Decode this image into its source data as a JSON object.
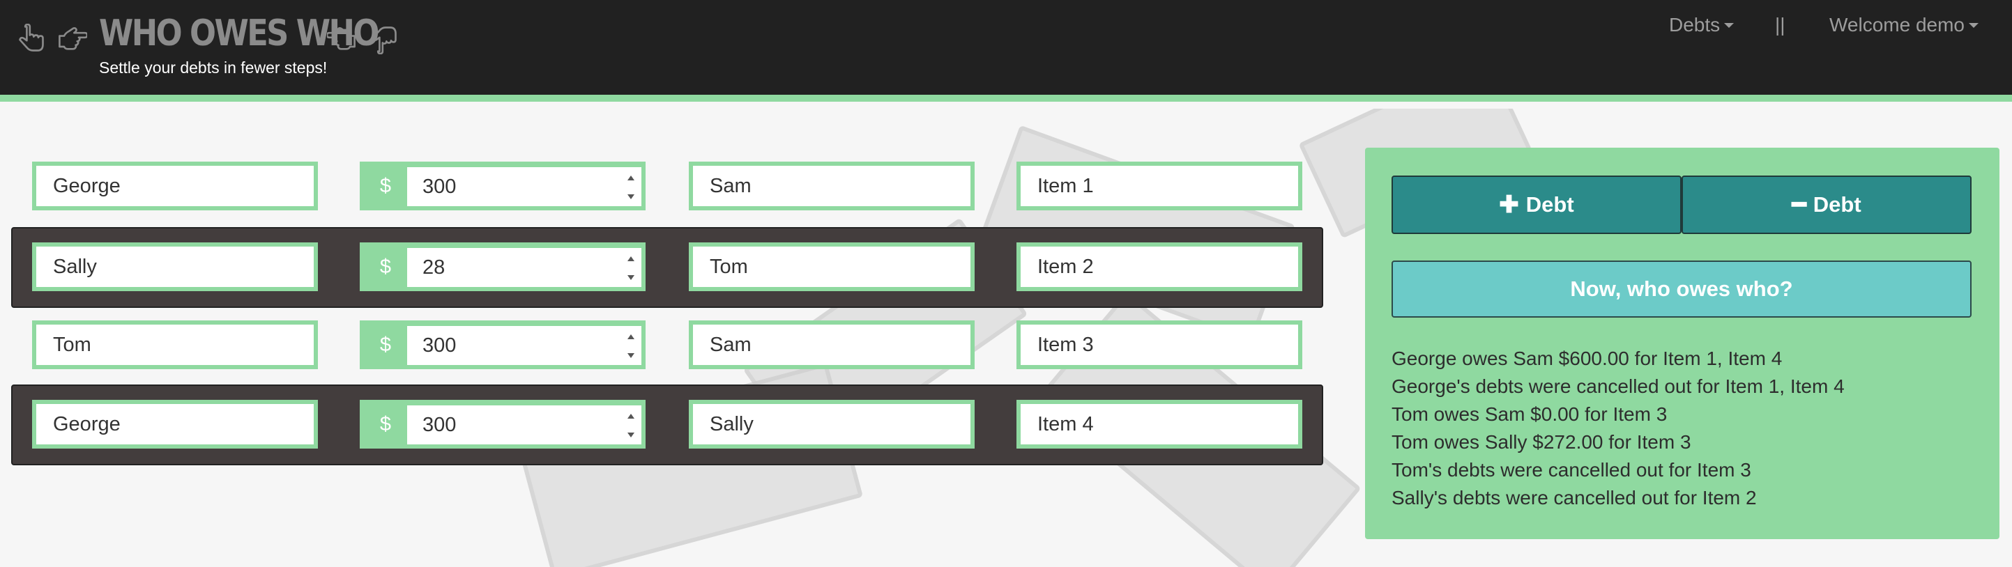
{
  "header": {
    "title": "WHO OWES WHO",
    "subtitle": "Settle your debts in fewer steps!",
    "icons": [
      "hand-point-down-icon",
      "hand-point-right-icon",
      "hand-point-left-icon",
      "hand-point-up-icon"
    ],
    "nav": {
      "debts_label": "Debts",
      "divider": "||",
      "welcome_label": "Welcome demo"
    }
  },
  "debts": [
    {
      "debtor": "George",
      "currency": "$",
      "amount": "300",
      "creditor": "Sam",
      "item": "Item 1"
    },
    {
      "debtor": "Sally",
      "currency": "$",
      "amount": "28",
      "creditor": "Tom",
      "item": "Item 2"
    },
    {
      "debtor": "Tom",
      "currency": "$",
      "amount": "300",
      "creditor": "Sam",
      "item": "Item 3"
    },
    {
      "debtor": "George",
      "currency": "$",
      "amount": "300",
      "creditor": "Sally",
      "item": "Item 4"
    }
  ],
  "panel": {
    "add_debt_label": "Debt",
    "remove_debt_label": "Debt",
    "who_owes_label": "Now, who owes who?",
    "results": [
      "George owes Sam $600.00 for Item 1, Item 4",
      "George's debts were cancelled out for Item 1, Item 4",
      "Tom owes Sam $0.00 for Item 3",
      "Tom owes Sally $272.00 for Item 3",
      "Tom's debts were cancelled out for Item 3",
      "Sally's debts were cancelled out for Item 2"
    ]
  },
  "colors": {
    "navbar": "#212121",
    "accent_green": "#8fd9a0",
    "teal_button": "#2b8b8a",
    "light_teal_button": "#6ccbc8",
    "alt_row": "#433d3d"
  }
}
